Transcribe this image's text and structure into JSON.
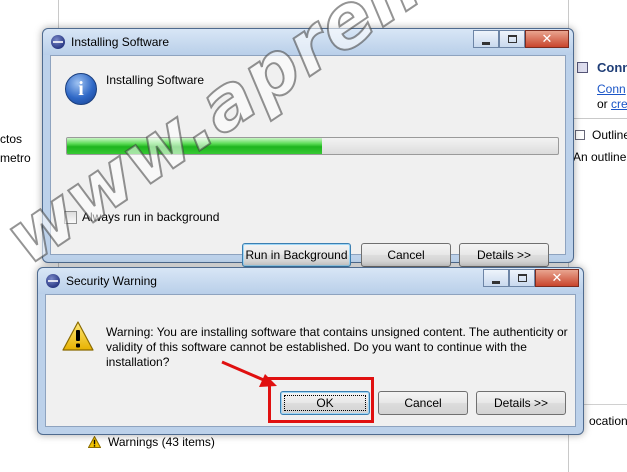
{
  "background": {
    "left_text": [
      "ctos",
      "metro"
    ],
    "right_panel": {
      "heading": "Conn",
      "link": "Conn",
      "or_text": "or",
      "or_link": "cre",
      "outline_title": "Outline",
      "outline_text": "An outline",
      "location_text": "ocation"
    },
    "problems_row": "Warnings (43 items)"
  },
  "install_dialog": {
    "title": "Installing Software",
    "heading": "Installing Software",
    "progress": 0.52,
    "checkbox_label": "Always run in background",
    "checkbox_checked": false,
    "buttons": {
      "run_in_background": "Run in Background",
      "cancel": "Cancel",
      "details": "Details >>"
    }
  },
  "security_dialog": {
    "title": "Security Warning",
    "message": "Warning: You are installing software that contains unsigned content. The authenticity or validity of this software cannot be established. Do you want to continue with the installation?",
    "buttons": {
      "ok": "OK",
      "cancel": "Cancel",
      "details": "Details >>"
    }
  },
  "watermark": "www.aprendeandroid.com",
  "colors": {
    "annotation_red": "#e01010",
    "progress_green": "#1eb51e",
    "frame_blue": "#bcd1ea"
  }
}
